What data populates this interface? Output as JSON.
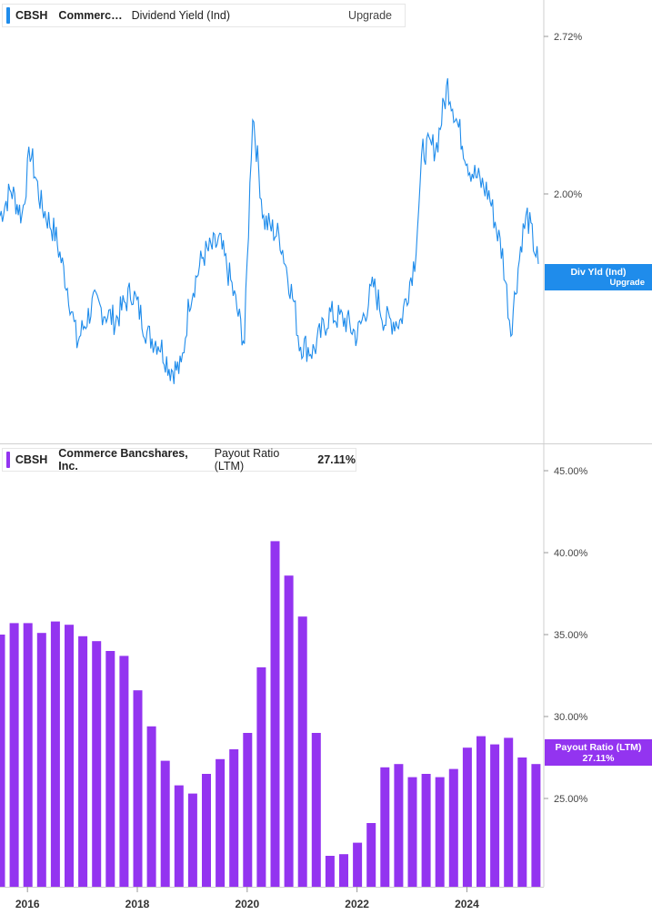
{
  "top_panel": {
    "legend": {
      "ticker": "CBSH",
      "name": "Commerc…",
      "metric": "Dividend Yield (Ind)",
      "upgrade_label": "Upgrade"
    },
    "badge": {
      "line1": "Div Yld (Ind)",
      "line2": "Upgrade"
    },
    "color": "#1f8ceb"
  },
  "bottom_panel": {
    "legend": {
      "ticker": "CBSH",
      "name": "Commerce Bancshares, Inc.",
      "metric": "Payout Ratio (LTM)",
      "value": "27.11%"
    },
    "badge": {
      "line1": "Payout Ratio (LTM)",
      "line2": "27.11%"
    },
    "color": "#9334f0"
  },
  "x_axis": {
    "ticks": [
      "2016",
      "2018",
      "2020",
      "2022",
      "2024"
    ]
  },
  "chart_data": [
    {
      "type": "line",
      "title": "Dividend Yield (Ind)",
      "y_unit": "%",
      "yticks": [
        "2.72%",
        "2.00%"
      ],
      "ytick_values": [
        2.72,
        2.0
      ],
      "x_start": 2015.5,
      "x_end": 2025.4,
      "x": [
        2015.5,
        2015.7,
        2015.9,
        2016.05,
        2016.25,
        2016.5,
        2016.75,
        2016.9,
        2017.2,
        2017.6,
        2017.9,
        2018.2,
        2018.4,
        2018.6,
        2018.8,
        2018.95,
        2019.2,
        2019.5,
        2019.7,
        2019.95,
        2020.1,
        2020.3,
        2020.6,
        2020.85,
        2020.95,
        2021.2,
        2021.5,
        2021.8,
        2022.0,
        2022.3,
        2022.5,
        2022.8,
        2023.05,
        2023.2,
        2023.45,
        2023.65,
        2023.85,
        2024.05,
        2024.4,
        2024.65,
        2024.8,
        2025.0,
        2025.1,
        2025.3
      ],
      "y": [
        1.9,
        2.02,
        1.9,
        2.2,
        1.95,
        1.82,
        1.55,
        1.32,
        1.5,
        1.42,
        1.56,
        1.35,
        1.32,
        1.2,
        1.2,
        1.52,
        1.72,
        1.78,
        1.6,
        1.32,
        2.38,
        1.88,
        1.8,
        1.5,
        1.32,
        1.28,
        1.45,
        1.42,
        1.35,
        1.58,
        1.42,
        1.42,
        1.7,
        2.2,
        2.22,
        2.5,
        2.3,
        2.12,
        2.0,
        1.72,
        1.38,
        1.8,
        1.9,
        1.68
      ]
    },
    {
      "type": "bar",
      "title": "Payout Ratio (LTM)",
      "y_unit": "%",
      "yticks": [
        "45.00%",
        "40.00%",
        "35.00%",
        "30.00%",
        "25.00%"
      ],
      "ytick_values": [
        45,
        40,
        35,
        30,
        25
      ],
      "x_start": 2015.5,
      "x_end": 2025.4,
      "x": [
        2015.5,
        2015.75,
        2016.0,
        2016.25,
        2016.5,
        2016.75,
        2017.0,
        2017.25,
        2017.5,
        2017.75,
        2018.0,
        2018.25,
        2018.5,
        2018.75,
        2019.0,
        2019.25,
        2019.5,
        2019.75,
        2020.0,
        2020.25,
        2020.5,
        2020.75,
        2021.0,
        2021.25,
        2021.5,
        2021.75,
        2022.0,
        2022.25,
        2022.5,
        2022.75,
        2023.0,
        2023.25,
        2023.5,
        2023.75,
        2024.0,
        2024.25,
        2024.5,
        2024.75,
        2025.0,
        2025.25
      ],
      "values": [
        35.0,
        35.7,
        35.7,
        35.1,
        35.8,
        35.6,
        34.9,
        34.6,
        34.0,
        33.7,
        31.6,
        29.4,
        27.3,
        25.8,
        25.3,
        26.5,
        27.4,
        28.0,
        29.0,
        33.0,
        40.7,
        38.6,
        36.1,
        29.0,
        21.5,
        21.6,
        22.3,
        23.5,
        26.9,
        27.1,
        26.3,
        26.5,
        26.3,
        26.8,
        28.1,
        28.8,
        28.3,
        28.7,
        27.5,
        27.1
      ],
      "bar_color": "#9334f0"
    }
  ]
}
